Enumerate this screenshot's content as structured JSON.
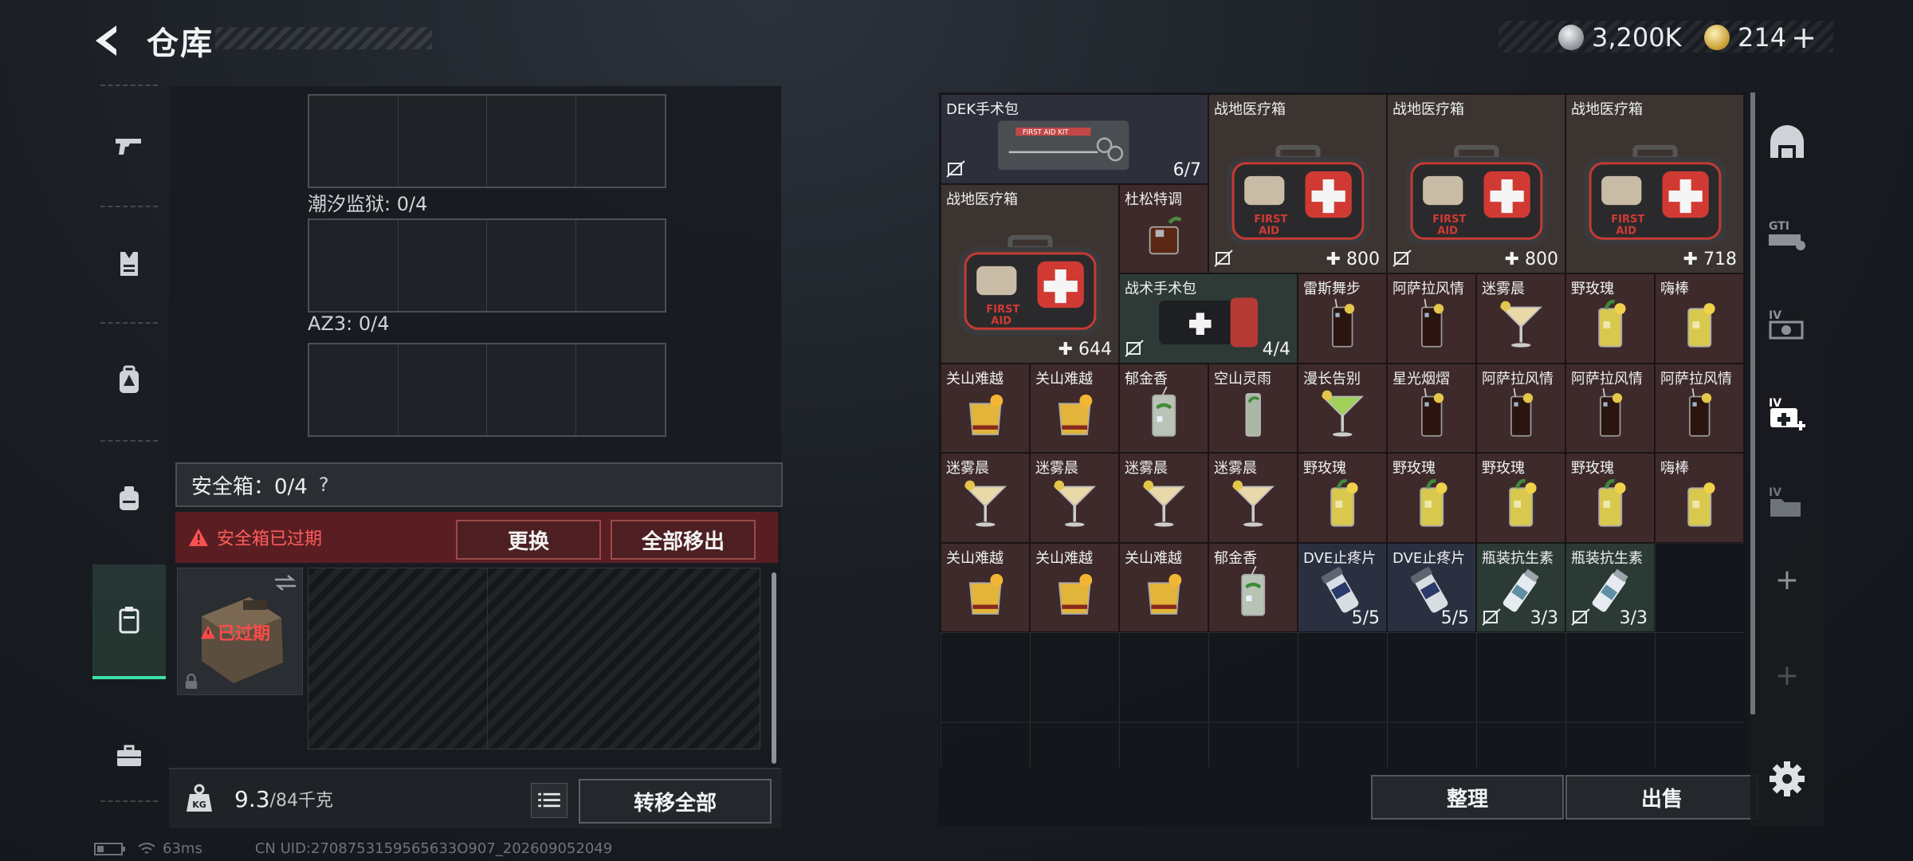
{
  "header": {
    "title": "仓库",
    "currency1": "3,200K",
    "currency2": "214",
    "add_label": "+",
    "coin1_color": "#c9ccd0",
    "coin2_color": "#d9b44a"
  },
  "left_rail": {
    "items": [
      {
        "icon": "pistol-icon"
      },
      {
        "icon": "vest-icon"
      },
      {
        "icon": "backpack-icon"
      },
      {
        "icon": "rig-icon"
      },
      {
        "icon": "safe-case-icon",
        "active": true
      },
      {
        "icon": "briefcase-icon"
      }
    ]
  },
  "loadout": {
    "grid2_label": "潮汐监狱: 0/4",
    "grid3_label": "AZ3: 0/4",
    "safe_label": "安全箱：0/4",
    "help_mark": "?",
    "expired_warning": "安全箱已过期",
    "replace_button": "更换",
    "remove_all_button": "全部移出",
    "expired_tag": "已过期",
    "weight_value": "9.3",
    "weight_capacity": "/84千克",
    "transfer_all_button": "转移全部"
  },
  "status_bar": {
    "ping": "63ms",
    "uid": "CN UID:2708753159565633O907_202609052049"
  },
  "warehouse": {
    "items": [
      {
        "id": "dek",
        "name": "DEK手术包",
        "count": "6/7",
        "type": "kit",
        "bg": "dark",
        "noicon": true
      },
      {
        "id": "med1",
        "name": "战地医疗箱",
        "count": "800",
        "type": "medbox",
        "bg": "brown",
        "noicon": true,
        "plus": true
      },
      {
        "id": "med2",
        "name": "战地医疗箱",
        "count": "800",
        "type": "medbox",
        "bg": "brown",
        "noicon": true,
        "plus": true
      },
      {
        "id": "med3",
        "name": "战地医疗箱",
        "count": "718",
        "type": "medbox",
        "bg": "brown",
        "noicon": false,
        "plus": true
      },
      {
        "id": "med4",
        "name": "战地医疗箱",
        "count": "644",
        "type": "medbox",
        "bg": "brown",
        "noicon": false,
        "plus": true
      },
      {
        "id": "dusong",
        "name": "杜松特调",
        "count": "",
        "type": "rocks",
        "bg": "red"
      },
      {
        "id": "zhanshu",
        "name": "战术手术包",
        "count": "4/4",
        "type": "pouch",
        "bg": "green",
        "noicon": true
      },
      {
        "id": "r2c1",
        "name": "雷斯舞步",
        "count": "",
        "type": "cola",
        "bg": "red"
      },
      {
        "id": "r2c2",
        "name": "阿萨拉风情",
        "count": "",
        "type": "cola",
        "bg": "red"
      },
      {
        "id": "r2c3",
        "name": "迷雾晨",
        "count": "",
        "type": "coupe",
        "bg": "red"
      },
      {
        "id": "r2c4",
        "name": "野玫瑰",
        "count": "",
        "type": "lemon",
        "bg": "red"
      },
      {
        "id": "r2c5",
        "name": "嗨棒",
        "count": "",
        "type": "highball",
        "bg": "red"
      },
      {
        "id": "r3c1",
        "name": "关山难越",
        "count": "",
        "type": "orange",
        "bg": "red"
      },
      {
        "id": "r3c2",
        "name": "关山难越",
        "count": "",
        "type": "orange",
        "bg": "red"
      },
      {
        "id": "r3c3",
        "name": "郁金香",
        "count": "",
        "type": "mojito",
        "bg": "red"
      },
      {
        "id": "r3c4",
        "name": "空山灵雨",
        "count": "",
        "type": "tall",
        "bg": "red"
      },
      {
        "id": "r3c5",
        "name": "漫长告别",
        "count": "",
        "type": "martini",
        "bg": "red"
      },
      {
        "id": "r3c6",
        "name": "星光烟熠",
        "count": "",
        "type": "cola",
        "bg": "red"
      },
      {
        "id": "r3c7",
        "name": "阿萨拉风情",
        "count": "",
        "type": "cola",
        "bg": "red"
      },
      {
        "id": "r3c8",
        "name": "阿萨拉风情",
        "count": "",
        "type": "cola",
        "bg": "red"
      },
      {
        "id": "r3c9",
        "name": "阿萨拉风情",
        "count": "",
        "type": "cola",
        "bg": "red"
      },
      {
        "id": "r4c1",
        "name": "迷雾晨",
        "count": "",
        "type": "coupe",
        "bg": "red"
      },
      {
        "id": "r4c2",
        "name": "迷雾晨",
        "count": "",
        "type": "coupe",
        "bg": "red"
      },
      {
        "id": "r4c3",
        "name": "迷雾晨",
        "count": "",
        "type": "coupe",
        "bg": "red"
      },
      {
        "id": "r4c4",
        "name": "迷雾晨",
        "count": "",
        "type": "coupe",
        "bg": "red"
      },
      {
        "id": "r4c5",
        "name": "野玫瑰",
        "count": "",
        "type": "lemon",
        "bg": "red"
      },
      {
        "id": "r4c6",
        "name": "野玫瑰",
        "count": "",
        "type": "lemon",
        "bg": "red"
      },
      {
        "id": "r4c7",
        "name": "野玫瑰",
        "count": "",
        "type": "lemon",
        "bg": "red"
      },
      {
        "id": "r4c8",
        "name": "野玫瑰",
        "count": "",
        "type": "lemon",
        "bg": "red"
      },
      {
        "id": "r4c9",
        "name": "嗨棒",
        "count": "",
        "type": "highball",
        "bg": "red"
      },
      {
        "id": "r5c1",
        "name": "关山难越",
        "count": "",
        "type": "orange",
        "bg": "red"
      },
      {
        "id": "r5c2",
        "name": "关山难越",
        "count": "",
        "type": "orange",
        "bg": "red"
      },
      {
        "id": "r5c3",
        "name": "关山难越",
        "count": "",
        "type": "orange",
        "bg": "red"
      },
      {
        "id": "r5c4",
        "name": "郁金香",
        "count": "",
        "type": "mojito",
        "bg": "red"
      },
      {
        "id": "r5c5",
        "name": "DVE止疼片",
        "count": "5/5",
        "type": "pills",
        "bg": "blue"
      },
      {
        "id": "r5c6",
        "name": "DVE止疼片",
        "count": "5/5",
        "type": "pills",
        "bg": "blue"
      },
      {
        "id": "r5c7",
        "name": "瓶装抗生素",
        "count": "3/3",
        "type": "vial",
        "bg": "teal",
        "noicon": true
      },
      {
        "id": "r5c8",
        "name": "瓶装抗生素",
        "count": "3/3",
        "type": "vial",
        "bg": "teal",
        "noicon": true
      }
    ],
    "sort_button": "整理",
    "sell_button": "出售"
  },
  "right_rail": {
    "items": [
      {
        "icon": "arch-icon"
      },
      {
        "icon": "warehouse-gti-icon"
      },
      {
        "icon": "warehouse-iv-camera-icon"
      },
      {
        "icon": "warehouse-iv-med-icon"
      },
      {
        "icon": "warehouse-iv-folder-icon"
      },
      {
        "icon": "add-icon",
        "label": "+"
      },
      {
        "icon": "add-disabled-icon",
        "label": "+"
      }
    ]
  }
}
